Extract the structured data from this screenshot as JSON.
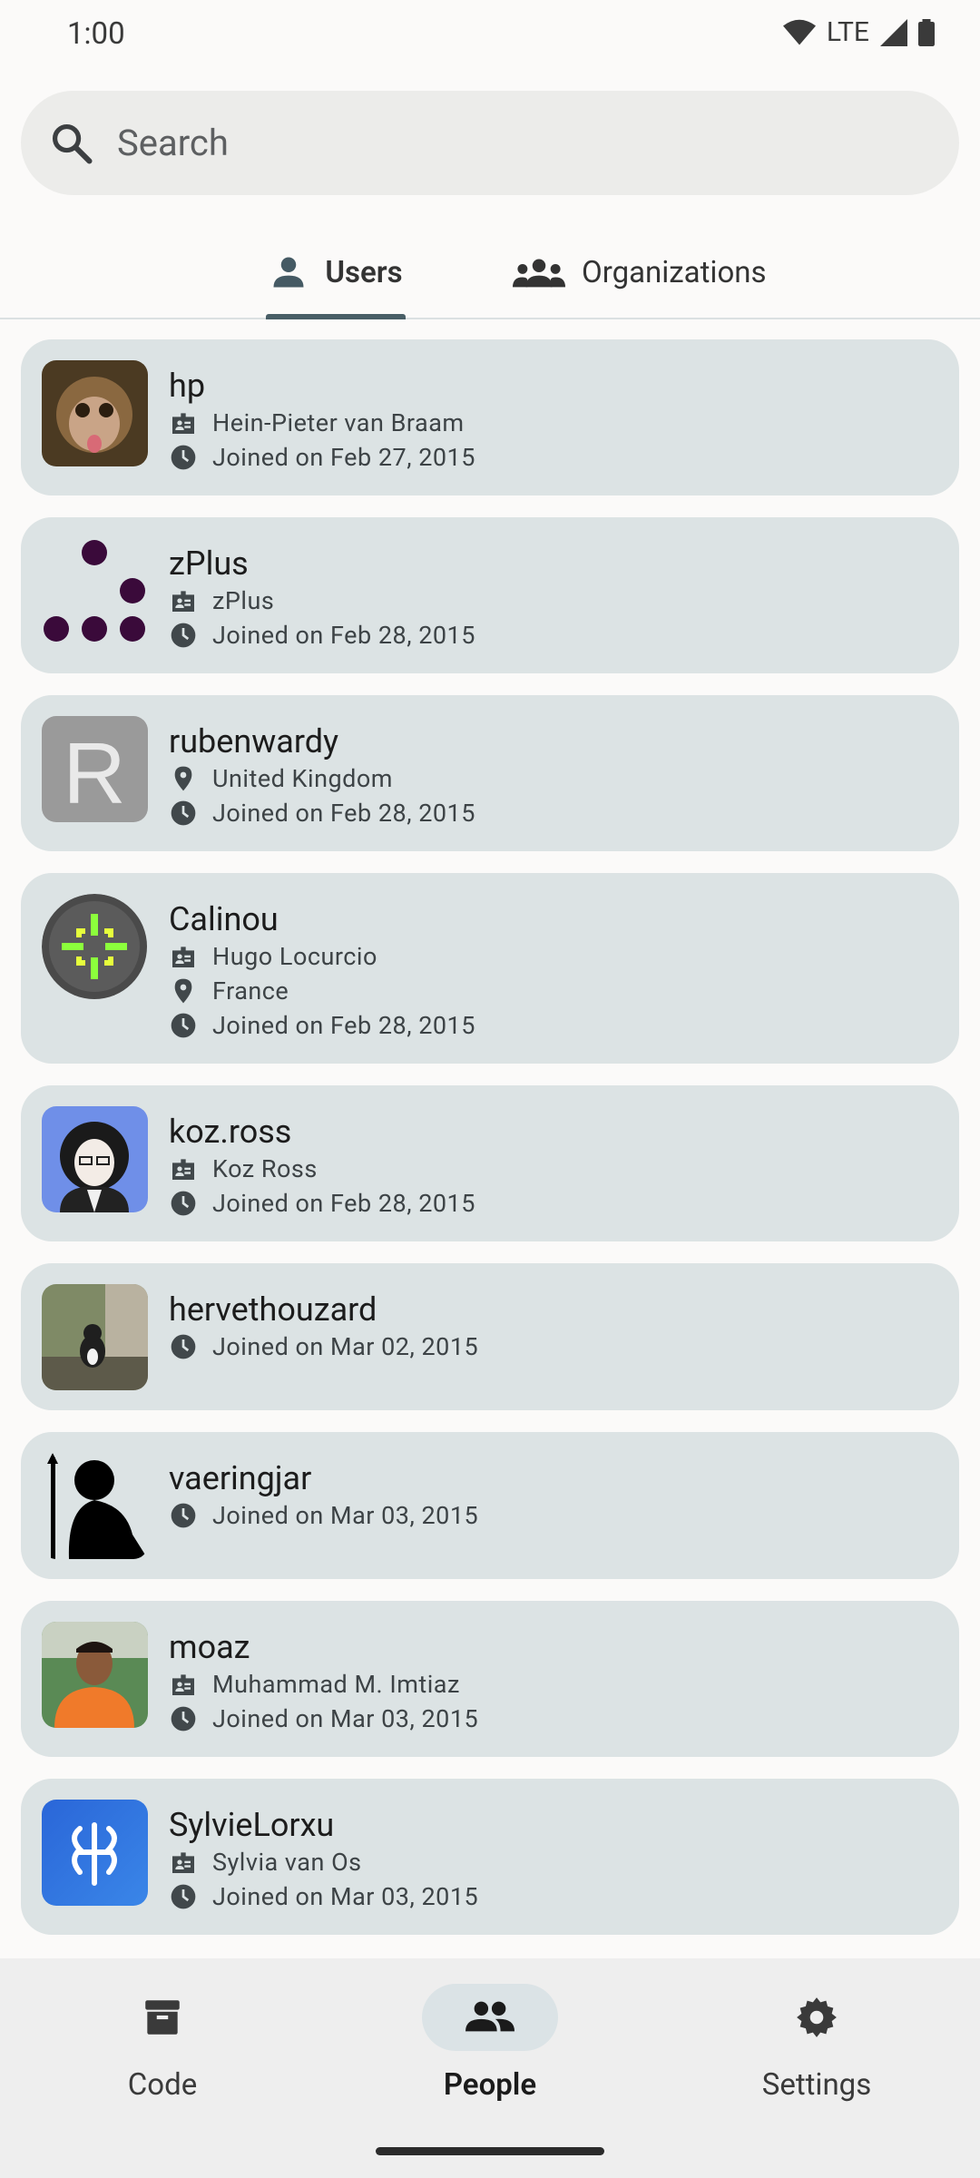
{
  "status": {
    "time": "1:00",
    "network": "LTE"
  },
  "search": {
    "placeholder": "Search"
  },
  "tabs": [
    {
      "label": "Users",
      "selected": true
    },
    {
      "label": "Organizations",
      "selected": false
    }
  ],
  "users": [
    {
      "username": "hp",
      "full_name": "Hein-Pieter van Braam",
      "joined": "Joined on Feb 27, 2015"
    },
    {
      "username": "zPlus",
      "full_name": "zPlus",
      "joined": "Joined on Feb 28, 2015"
    },
    {
      "username": "rubenwardy",
      "location": "United Kingdom",
      "joined": "Joined on Feb 28, 2015"
    },
    {
      "username": "Calinou",
      "full_name": "Hugo Locurcio",
      "location": "France",
      "joined": "Joined on Feb 28, 2015"
    },
    {
      "username": "koz.ross",
      "full_name": "Koz Ross",
      "joined": "Joined on Feb 28, 2015"
    },
    {
      "username": "hervethouzard",
      "joined": "Joined on Mar 02, 2015"
    },
    {
      "username": "vaeringjar",
      "joined": "Joined on Mar 03, 2015"
    },
    {
      "username": "moaz",
      "full_name": "Muhammad M. Imtiaz",
      "joined": "Joined on Mar 03, 2015"
    },
    {
      "username": "SylvieLorxu",
      "full_name": "Sylvia van Os",
      "joined": "Joined on Mar 03, 2015"
    }
  ],
  "nav": [
    {
      "label": "Code"
    },
    {
      "label": "People",
      "selected": true
    },
    {
      "label": "Settings"
    }
  ],
  "colors": {
    "card": "#dce3e4",
    "accent": "#485e66"
  }
}
